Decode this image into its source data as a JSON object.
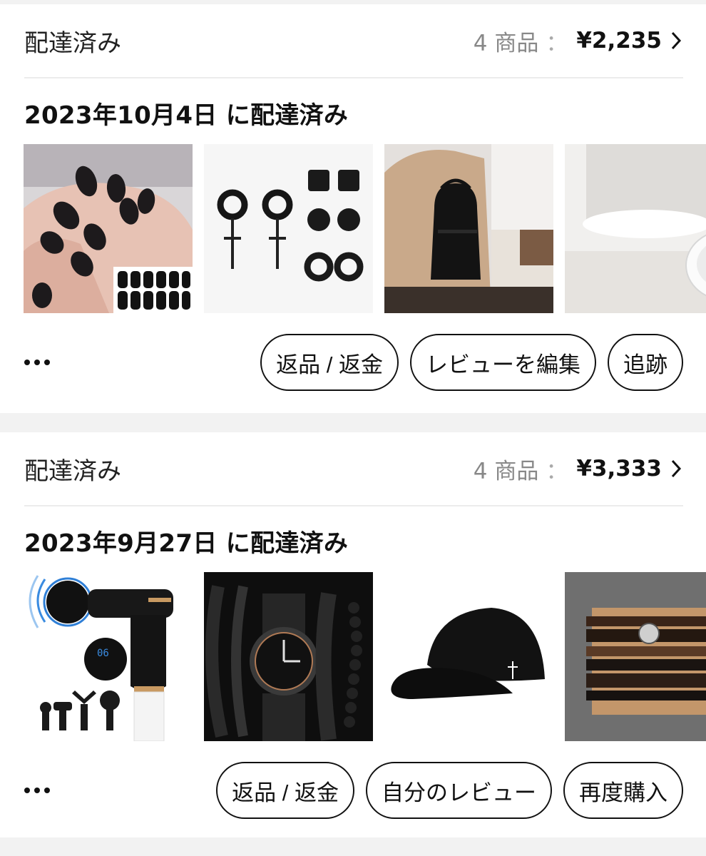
{
  "orders": [
    {
      "status": "配達済み",
      "count": "4 商品",
      "colon": "：",
      "total": "¥2,235",
      "date": "2023年10月4日 に配達済み",
      "products": [
        "nail-stickers-icon",
        "earrings-icon",
        "backpack-icon",
        "tape-roll-icon"
      ],
      "buttons": [
        "返品 / 返金",
        "レビューを編集",
        "追跡"
      ]
    },
    {
      "status": "配達済み",
      "count": "4 商品",
      "colon": "：",
      "total": "¥3,333",
      "date": "2023年9月27日 に配達済み",
      "products": [
        "massage-gun-icon",
        "watch-bracelet-icon",
        "cap-icon",
        "leather-bracelet-icon"
      ],
      "buttons": [
        "返品 / 返金",
        "自分のレビュー",
        "再度購入"
      ]
    }
  ]
}
